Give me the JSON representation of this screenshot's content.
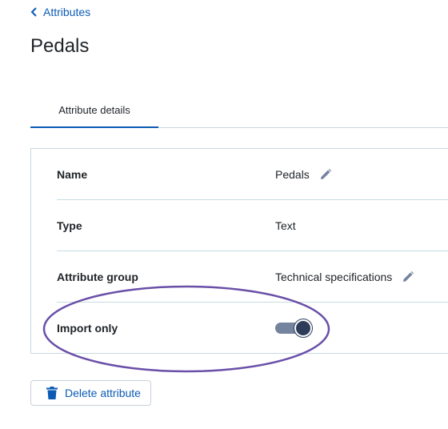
{
  "breadcrumb": {
    "label": "Attributes",
    "icon": "chevron-left-icon"
  },
  "page": {
    "title": "Pedals"
  },
  "tabs": [
    {
      "label": "Attribute details",
      "active": true
    }
  ],
  "details": {
    "rows": [
      {
        "label": "Name",
        "value": "Pedals",
        "editable": true
      },
      {
        "label": "Type",
        "value": "Text",
        "editable": false
      },
      {
        "label": "Attribute group",
        "value": "Technical specifications",
        "editable": true
      },
      {
        "label": "Import only",
        "toggle": true,
        "toggle_on": true
      }
    ]
  },
  "actions": {
    "delete_label": "Delete attribute",
    "delete_icon": "trash-icon"
  },
  "colors": {
    "link": "#0b5bb5",
    "highlight_ring": "#6a4fa8",
    "toggle_track": "#74839e",
    "toggle_knob": "#2c3c59"
  }
}
